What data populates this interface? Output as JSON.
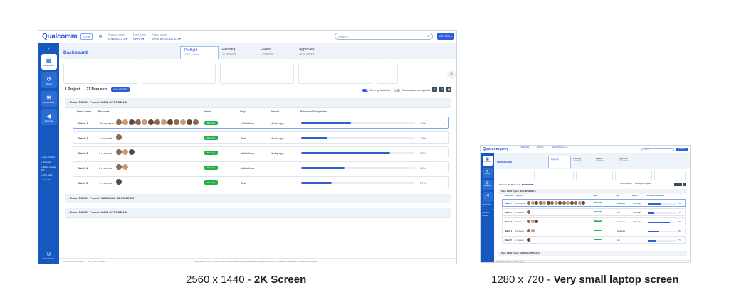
{
  "header": {
    "logo": "Qualcomm",
    "env_badge": "CDM",
    "selectors": [
      {
        "label": "Program name",
        "value": "CYBERUS 2 ▾"
      },
      {
        "label": "Team name",
        "value": "FWKR ▾"
      },
      {
        "label": "Project name",
        "value": "MAIN MPSS.DE.1.0 ▾"
      }
    ],
    "search_placeholder": "Search...",
    "action_label": "ACTION ▾"
  },
  "sidebar": {
    "items": [
      {
        "label": "Dashboard",
        "icon": "grid-icon"
      },
      {
        "label": "History",
        "icon": "history-icon"
      },
      {
        "label": "Bookmarks",
        "icon": "bookmark-icon"
      },
      {
        "label": "Promote",
        "icon": "megaphone-icon"
      }
    ],
    "links": [
      "+ Gen Profiles",
      "+ Promote",
      "+ Batch Create CR",
      "+ Port Jobs",
      "+ Reports"
    ],
    "user": "Nate Smith"
  },
  "dashboard": {
    "title": "Dashboard",
    "tabs": [
      {
        "label": "Preflight",
        "sub": "11/21 running"
      },
      {
        "label": "Pending",
        "sub": "10 Requests"
      },
      {
        "label": "Failed",
        "sub": "0 Requests"
      },
      {
        "label": "Approved",
        "sub": "26/26 running"
      }
    ]
  },
  "summary": {
    "projects": "1 Project",
    "requests": "21 Requests",
    "add_filter": "ADD FILTER",
    "view_batches": "View by batches",
    "show_system": "Show system requests"
  },
  "teams": [
    {
      "team": "Team: FWKR",
      "project": "Project: MAIN MPSS.DE.1.0"
    },
    {
      "team": "Team: FWKR",
      "project": "Project: SAMSUNG MPSS.CE.2.0"
    },
    {
      "team": "Team: FWKR",
      "project": "Project: MAIN MPSS.DE.1.0"
    }
  ],
  "table": {
    "columns": [
      "Batch Name",
      "Requests",
      "Status",
      "Step",
      "Started",
      "Estimated Completion"
    ],
    "rows": [
      {
        "batch": "Batch 1",
        "requests": "15 requests",
        "status": "Running",
        "step": "Validations",
        "started": "4 min ago",
        "percent": "44%",
        "progress": 0.44
      },
      {
        "batch": "Batch 2",
        "requests": "1 requests",
        "status": "Running",
        "step": "Test",
        "started": "4 min ago",
        "percent": "23%",
        "progress": 0.23
      },
      {
        "batch": "Batch 3",
        "requests": "3 requests",
        "status": "Running",
        "step": "Validations",
        "started": "1 day ago",
        "percent": "78%",
        "progress": 0.78
      },
      {
        "batch": "Batch 4",
        "requests": "2 requests",
        "status": "Running",
        "step": "Validations",
        "started": "",
        "percent": "38%",
        "progress": 0.38
      },
      {
        "batch": "Batch 5",
        "requests": "1 requests",
        "status": "Running",
        "step": "Test",
        "started": "",
        "percent": "27%",
        "progress": 0.27
      }
    ]
  },
  "footer": {
    "version": "Version 1860-4-Patch 3 · UI 1.16.24 · DEMO",
    "copyright": "Copyright (c) 2021 QUALCOMM Incorporated. All Rights Reserved. May contain U.S. or international export controlled information."
  },
  "captions": {
    "big_res": "2560 x 1440 - ",
    "big_desc": "2K Screen",
    "small_res": "1280 x 720 - ",
    "small_desc": "Very small laptop screen"
  }
}
